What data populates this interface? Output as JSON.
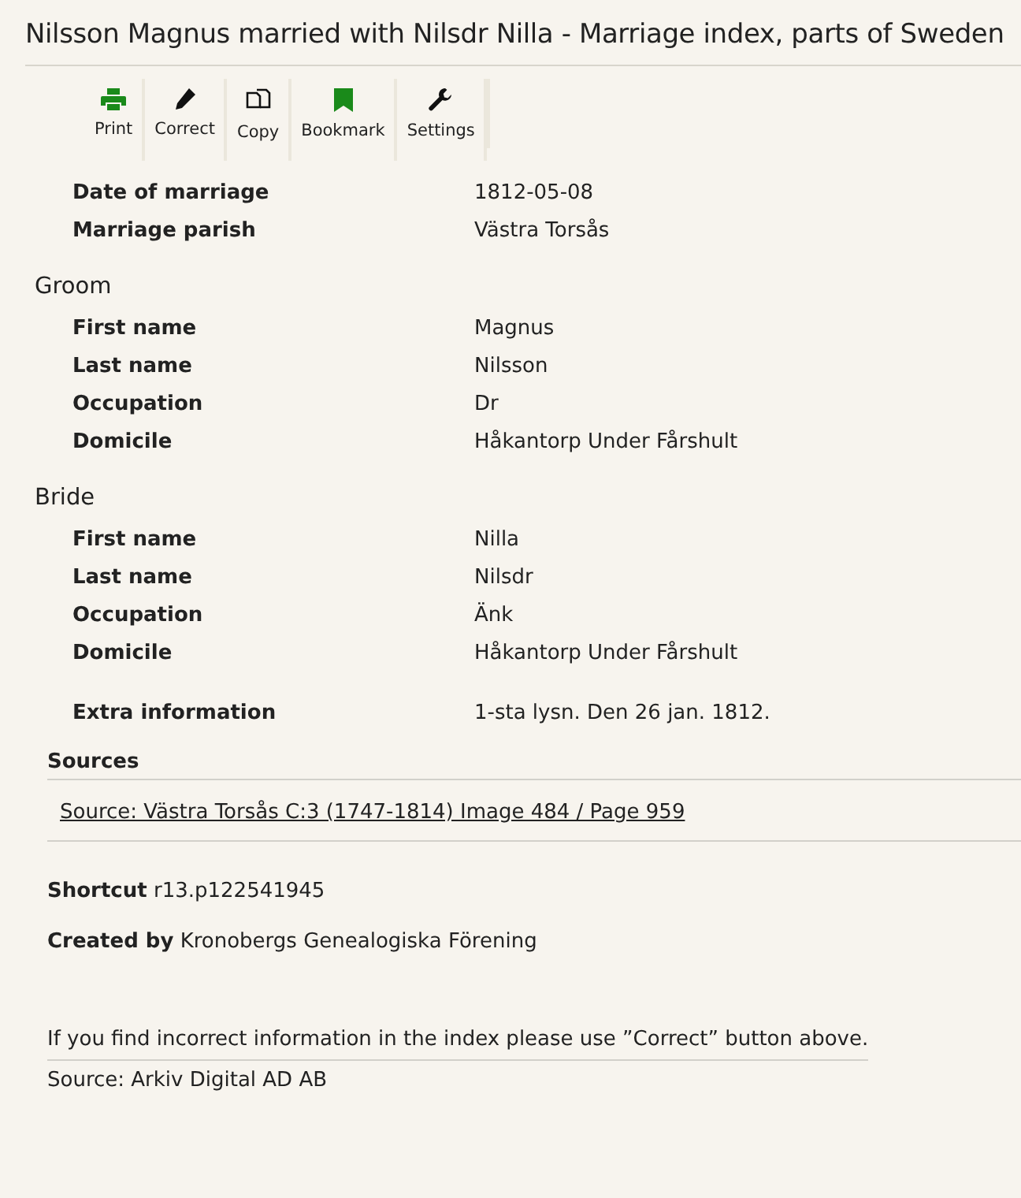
{
  "title": "Nilsson Magnus married with Nilsdr Nilla - Marriage index, parts of Sweden",
  "toolbar": [
    {
      "label": "Print",
      "kind": "print"
    },
    {
      "label": "Correct",
      "kind": "edit"
    },
    {
      "label": "Copy",
      "kind": "copy"
    },
    {
      "label": "Bookmark",
      "kind": "bookmark"
    },
    {
      "label": "Settings",
      "kind": "settings"
    }
  ],
  "fields": [
    {
      "label": "Date of marriage",
      "value": "1812-05-08"
    },
    {
      "label": "Marriage parish",
      "value": "Västra Torsås"
    }
  ],
  "groups": [
    {
      "heading": "Groom",
      "fields": [
        {
          "label": "First name",
          "value": "Magnus"
        },
        {
          "label": "Last name",
          "value": "Nilsson"
        },
        {
          "label": "Occupation",
          "value": "Dr"
        },
        {
          "label": "Domicile",
          "value": "Håkantorp Under Fårshult"
        }
      ]
    },
    {
      "heading": "Bride",
      "fields": [
        {
          "label": "First name",
          "value": "Nilla"
        },
        {
          "label": "Last name",
          "value": "Nilsdr"
        },
        {
          "label": "Occupation",
          "value": "Änk"
        },
        {
          "label": "Domicile",
          "value": "Håkantorp Under Fårshult"
        }
      ]
    }
  ],
  "extra_fields": [
    {
      "label": "Extra information",
      "value": "1-sta lysn. Den 26 jan. 1812."
    }
  ],
  "sources": {
    "heading": "Sources",
    "links": [
      "Source: Västra Torsås C:3 (1747-1814) Image 484 / Page 959"
    ]
  },
  "shortcut": "**Shortcut** r13.p122541945",
  "created_by": "**Created by** Kronobergs Genealogiska Förening",
  "notice": "If you find incorrect information in the index please use ”Correct” button above.",
  "footer": "Source: Arkiv Digital AD AB"
}
